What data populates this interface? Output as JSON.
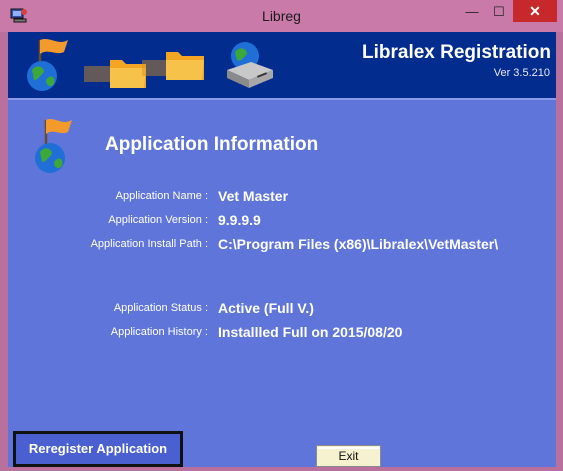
{
  "window": {
    "title": "Libreg",
    "minimize_glyph": "—",
    "maximize_glyph": "☐",
    "close_glyph": "✕"
  },
  "banner": {
    "title": "Libralex Registration",
    "version": "Ver 3.5.210"
  },
  "section": {
    "title": "Application Information"
  },
  "fields": [
    {
      "label": "Application Name :",
      "value": "Vet Master"
    },
    {
      "label": "Application Version :",
      "value": "9.9.9.9"
    },
    {
      "label": "Application Install Path :",
      "value": "C:\\Program Files (x86)\\Libralex\\VetMaster\\"
    },
    {
      "label": "Application Status :",
      "value": "Active (Full V.)"
    },
    {
      "label": "Application History :",
      "value": "Installled Full on 2015/08/20"
    }
  ],
  "buttons": {
    "reregister": "Reregister Application",
    "exit": "Exit"
  },
  "icons": {
    "app": "registration-app-icon",
    "banner": [
      "globe-flag-icon",
      "folder-icon",
      "folder-icon",
      "server-icon"
    ],
    "section": "globe-flag-icon"
  },
  "colors": {
    "titlebar": "#c97aa8",
    "close": "#c6282b",
    "banner": "#032c8f",
    "client": "#6075d9"
  }
}
